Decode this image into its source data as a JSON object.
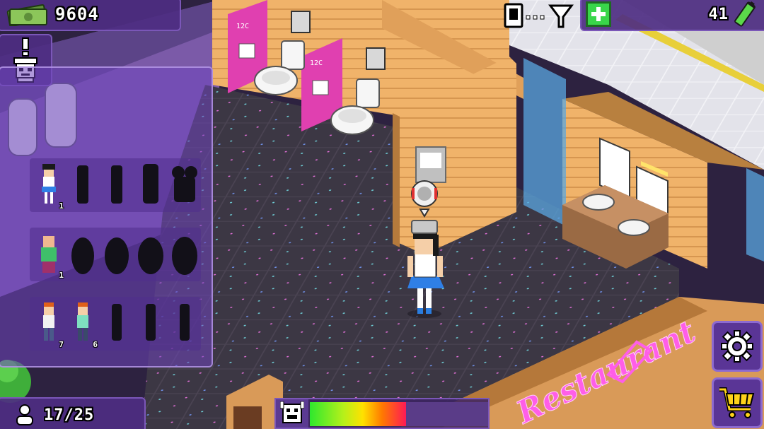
{
  "hud": {
    "money": "9604",
    "energy": "41",
    "capacity": "17/25",
    "mood_level": 0.54
  },
  "icons": {
    "money": "money-bills-icon",
    "alert": "alert-customer-icon",
    "signal": "phone-signal-icon",
    "add": "plus-icon",
    "energy": "battery-icon",
    "capacity": "person-icon",
    "mood": "happy-face-icon",
    "settings": "gear-icon",
    "shop": "shopping-cart-icon"
  },
  "customers": {
    "rows": [
      {
        "count": "1",
        "locked": 4
      },
      {
        "count": "1",
        "locked": 4
      },
      {
        "counts": [
          "7",
          "6"
        ],
        "locked": 3
      }
    ]
  },
  "scene": {
    "stall_labels": [
      "12C",
      "12C"
    ],
    "sign_text": "Restaurant"
  },
  "colors": {
    "panel": "#4e2e82",
    "neon": "#ff5ee8",
    "accent_green": "#39d64a"
  }
}
